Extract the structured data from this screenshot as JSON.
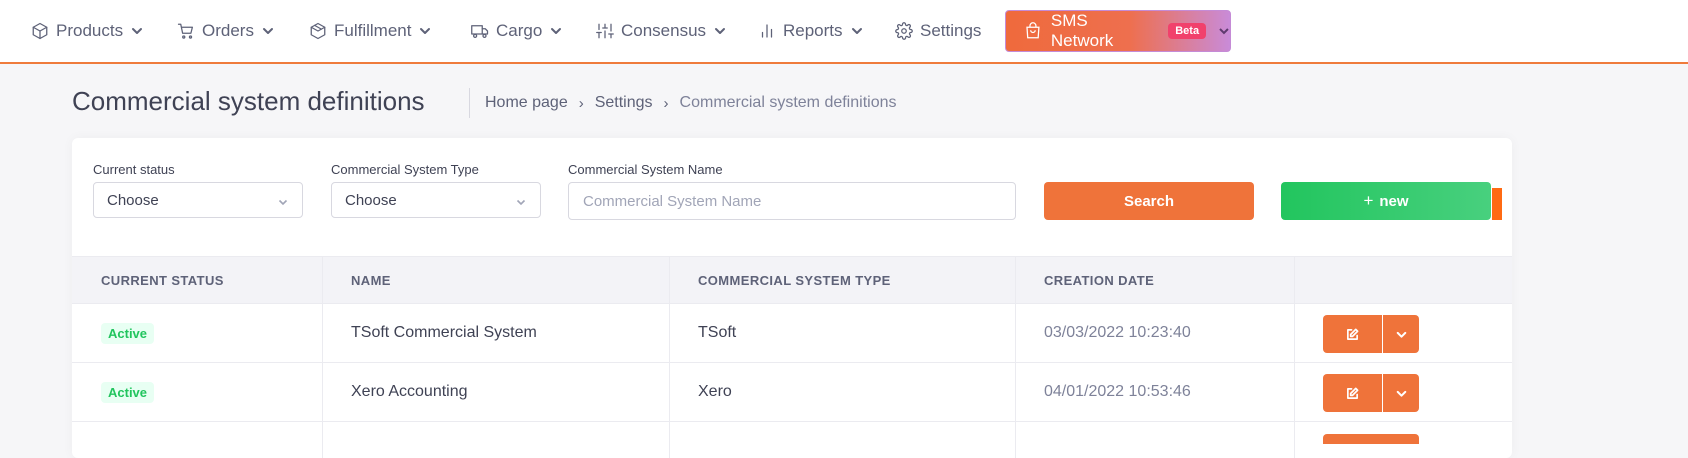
{
  "nav": {
    "items": [
      {
        "label": "Products",
        "icon": "box-icon"
      },
      {
        "label": "Orders",
        "icon": "cart-icon"
      },
      {
        "label": "Fulfillment",
        "icon": "cube-icon"
      },
      {
        "label": "Cargo",
        "icon": "truck-icon"
      },
      {
        "label": "Consensus",
        "icon": "sliders-icon"
      },
      {
        "label": "Reports",
        "icon": "bar-chart-icon"
      },
      {
        "label": "Settings",
        "icon": "gear-icon"
      }
    ],
    "sms": {
      "label": "SMS Network",
      "badge": "Beta",
      "icon": "shopping-bag-icon"
    },
    "accent": "#ef7b3c"
  },
  "page": {
    "title": "Commercial system definitions",
    "breadcrumb": [
      "Home page",
      "Settings",
      "Commercial system definitions"
    ]
  },
  "filters": {
    "status": {
      "label": "Current status",
      "value": "Choose"
    },
    "type": {
      "label": "Commercial System Type",
      "value": "Choose"
    },
    "name": {
      "label": "Commercial System Name",
      "placeholder": "Commercial System Name",
      "value": ""
    },
    "search_label": "Search",
    "new_label": "new",
    "search_color": "#ef733a",
    "new_color": "#22c55e"
  },
  "table": {
    "headers": [
      "CURRENT STATUS",
      "NAME",
      "COMMERCIAL SYSTEM TYPE",
      "CREATION DATE",
      ""
    ],
    "rows": [
      {
        "status": "Active",
        "name": "TSoft Commercial System",
        "type": "TSoft",
        "date": "03/03/2022 10:23:40"
      },
      {
        "status": "Active",
        "name": "Xero Accounting",
        "type": "Xero",
        "date": "04/01/2022 10:53:46"
      }
    ],
    "status_color": "#22c55e"
  }
}
